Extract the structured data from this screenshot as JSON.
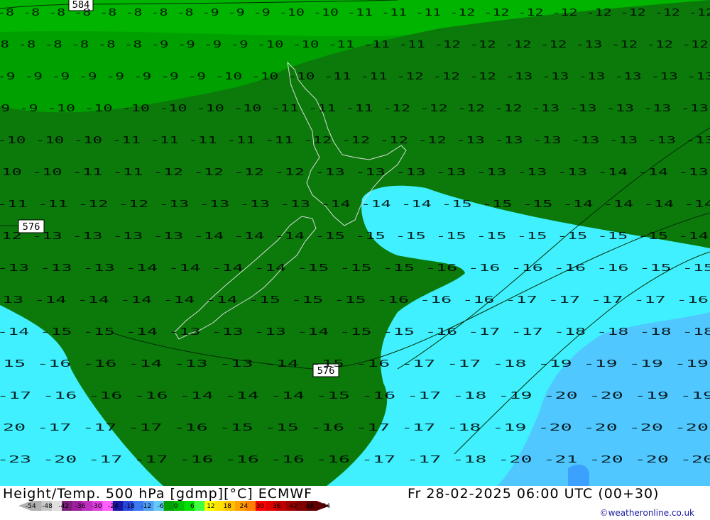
{
  "map": {
    "contour_labels": [
      "584",
      "576",
      "576"
    ],
    "temperature_field_rows": [
      "-8 -8 -8 -8 -8 -8 -8 -8 -9 -9 -9 -10 -10 -11 -11 -11 -12 -12 -12 -12 -12 -12 -12 -12",
      "-8 -8 -8 -8 -8 -8 -9 -9 -9 -9 -10 -10 -11 -11 -11 -12 -12 -12 -12 -13 -12 -12 -12",
      "-9 -9 -9 -9 -9 -9 -9 -9 -10 -10 -10 -11 -11 -12 -12 -12 -13 -13 -13 -13 -13 -13",
      "-9 -9 -10 -10 -10 -10 -10 -10 -11 -11 -11 -12 -12 -12 -12 -13 -13 -13 -13 -13",
      "-10 -10 -10 -11 -11 -11 -11 -11 -12 -12 -12 -12 -13 -13 -13 -13 -13 -13 -13",
      "-10 -10 -11 -11 -12 -12 -12 -12 -13 -13 -13 -13 -13 -13 -13 -14 -14 -13",
      "-11 -11 -12 -12 -13 -13 -13 -13 -14 -14 -14 -15 -15 -15 -14 -14 -14 -14",
      "-12 -13 -13 -13 -13 -14 -14 -14 -15 -15 -15 -15 -15 -15 -15 -15 -15 -14",
      "-13 -13 -13 -14 -14 -14 -14 -15 -15 -15 -16 -16 -16 -16 -16 -15 -15",
      "-13 -14 -14 -14 -14 -14 -15 -15 -15 -16 -16 -16 -17 -17 -17 -17 -16",
      "-14 -15 -15 -14 -13 -13 -13 -14 -15 -15 -16 -17 -17 -18 -18 -18 -18",
      "-15 -16 -16 -14 -13 -13 -14 -15 -16 -17 -17 -18 -19 -19 -19 -19",
      "-17 -16 -16 -16 -14 -14 -14 -15 -16 -17 -18 -19 -20 -20 -19 -19",
      "-20 -17 -17 -17 -16 -15 -15 -16 -17 -17 -18 -19 -20 -20 -20 -20",
      "-23 -20 -17 -17 -16 -16 -16 -16 -17 -17 -18 -20 -21 -20 -20 -20"
    ]
  },
  "footer": {
    "title": "Height/Temp. 500 hPa [gdmp][°C] ECMWF",
    "datetime": "Fr 28-02-2025 06:00 UTC (00+30)",
    "credit": "©weatheronline.co.uk",
    "scale_ticks": [
      "-54",
      "-48",
      "-42",
      "-36",
      "-30",
      "-24",
      "-18",
      "-12",
      "-6",
      "0",
      "6",
      "12",
      "18",
      "24",
      "30",
      "36",
      "42",
      "48",
      "54"
    ],
    "scale_colors": [
      "#b0b0b0",
      "#c8c8c8",
      "#e0e0e0",
      "#7a1f7a",
      "#a020a0",
      "#c030c0",
      "#e040e0",
      "#ff60ff",
      "#1818a0",
      "#2848e0",
      "#3c78f0",
      "#50a0f8",
      "#64c8f8",
      "#00a000",
      "#00c000",
      "#00e000",
      "#40ff40",
      "#ffff00",
      "#ffe000",
      "#ffc000",
      "#ffa000",
      "#ff8000",
      "#ff0000",
      "#e00000",
      "#c00000",
      "#a00000",
      "#800000",
      "#600000"
    ],
    "field_colors": {
      "dark_green": "#0b7a0b",
      "mid_green": "#00a000",
      "light_green": "#00b400",
      "cyan": "#40f0ff",
      "light_blue": "#50c8ff"
    }
  }
}
